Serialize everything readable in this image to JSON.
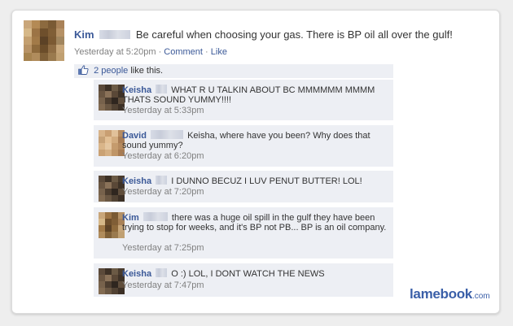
{
  "post": {
    "author": "Kim",
    "text": "Be careful when choosing your gas. There is BP oil all over the gulf!",
    "time": "Yesterday at 5:20pm",
    "separator": "·",
    "comment_link": "Comment",
    "like_link": "Like",
    "avatar_colors": [
      "#c9a67a",
      "#b48a55",
      "#8c6a3f",
      "#7a5a34",
      "#a98258",
      "#d6b888",
      "#9c7445",
      "#6e4f2c",
      "#805e36",
      "#b59166",
      "#c4a070",
      "#a27a48",
      "#5c4226",
      "#7c5a33",
      "#a1865f",
      "#b89366",
      "#8e6a3c",
      "#6b4d2a",
      "#8f6d44",
      "#c6a579",
      "#a6834f",
      "#b08c5c",
      "#7f6038",
      "#9a7a4e",
      "#c0a072"
    ]
  },
  "likes": {
    "icon": "thumbs-up-icon",
    "people": "2 people",
    "suffix": "like this."
  },
  "comments": [
    {
      "author": "Keisha",
      "text": "WHAT R U TALKIN ABOUT BC MMMMMM MMMM THATS SOUND YUMMY!!!!",
      "time": "Yesterday at 5:33pm",
      "avatar_colors": [
        "#5b4a3a",
        "#3d3126",
        "#6b5a45",
        "#4a3c2e",
        "#6a5642",
        "#8a7259",
        "#5a4837",
        "#3e3227",
        "#77624c",
        "#4d3e30",
        "#2f261f",
        "#5f4d3b",
        "#826b52",
        "#6a5743",
        "#514233",
        "#3c3026"
      ]
    },
    {
      "author": "David",
      "text": "Keisha, where have you been? Why does that sound yummy?",
      "time": "Yesterday at 6:20pm",
      "avatar_colors": [
        "#d8b48a",
        "#c99f72",
        "#e1c19a",
        "#b88d62",
        "#c7a277",
        "#e2bf94",
        "#d2ab7e",
        "#a97d55",
        "#d9b589",
        "#e4c6a0",
        "#c59b6d",
        "#b58a5f",
        "#caa274",
        "#d5b084",
        "#bf9567",
        "#a87c53"
      ]
    },
    {
      "author": "Keisha",
      "text": "I DUNNO BECUZ I LUV PENUT BUTTER! LOL!",
      "time": "Yesterday at 7:20pm",
      "avatar_colors": [
        "#5b4a3a",
        "#3d3126",
        "#6b5a45",
        "#4a3c2e",
        "#6a5642",
        "#8a7259",
        "#5a4837",
        "#3e3227",
        "#77624c",
        "#4d3e30",
        "#2f261f",
        "#5f4d3b",
        "#826b52",
        "#6a5743",
        "#514233",
        "#3c3026"
      ]
    },
    {
      "author": "Kim",
      "text": "there was a huge oil spill in the gulf they have been trying to stop for weeks, and it's BP not PB... BP is an oil company.",
      "time": "Yesterday at 7:25pm",
      "avatar_colors": [
        "#c9a67a",
        "#9c7445",
        "#7a5a34",
        "#b59166",
        "#d6b888",
        "#6e4f2c",
        "#805e36",
        "#a98258",
        "#a27a48",
        "#5c4226",
        "#8e6a3c",
        "#c6a579",
        "#b08c5c",
        "#7f6038",
        "#9a7a4e",
        "#c0a072"
      ]
    },
    {
      "author": "Keisha",
      "text": "O :) LOL, I DONT WATCH THE NEWS",
      "time": "Yesterday at 7:47pm",
      "avatar_colors": [
        "#5b4a3a",
        "#3d3126",
        "#6b5a45",
        "#4a3c2e",
        "#6a5642",
        "#8a7259",
        "#5a4837",
        "#3e3227",
        "#77624c",
        "#4d3e30",
        "#2f261f",
        "#5f4d3b",
        "#826b52",
        "#6a5743",
        "#514233",
        "#3c3026"
      ]
    }
  ],
  "watermark": {
    "name": "lamebook",
    "tld": ".com"
  },
  "colors": {
    "link": "#3b5998",
    "meta": "#808080",
    "comment_bg": "#edeff4"
  }
}
